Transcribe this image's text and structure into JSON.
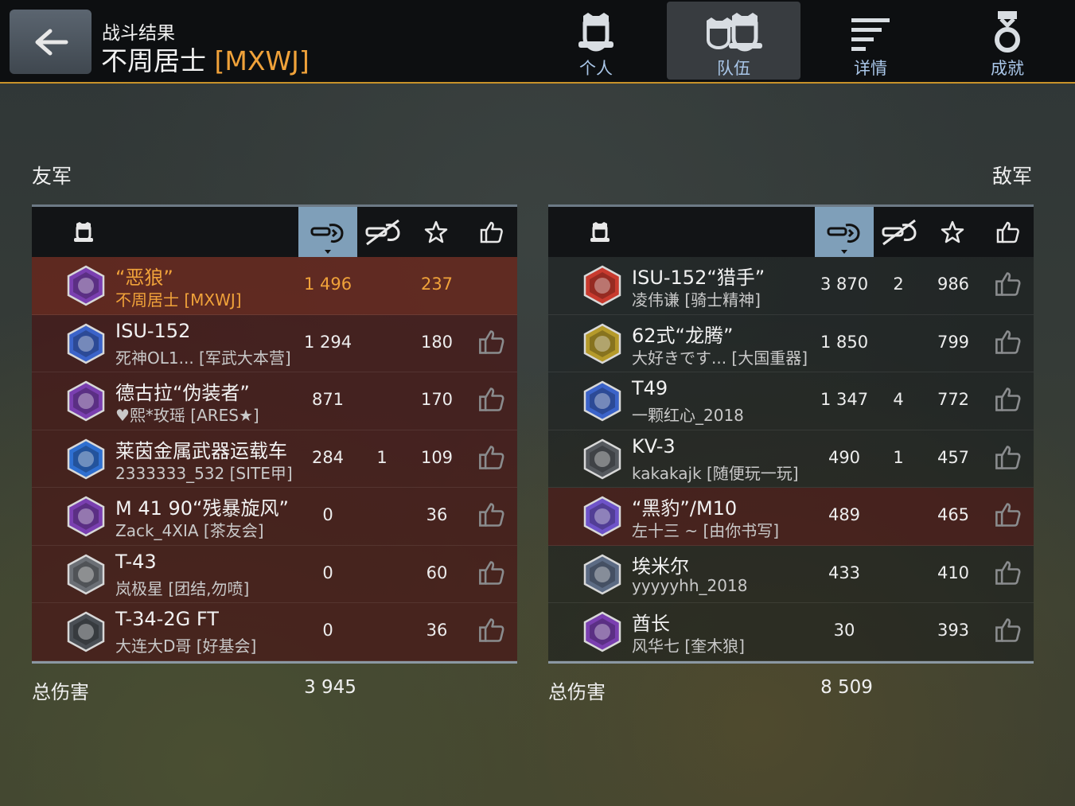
{
  "header": {
    "subtitle": "战斗结果",
    "player_name": "不周居士",
    "clan_tag": "[MXWJ]",
    "tabs": [
      {
        "label": "个人",
        "icon": "single-tank-icon",
        "active": false
      },
      {
        "label": "队伍",
        "icon": "team-tanks-icon",
        "active": true
      },
      {
        "label": "详情",
        "icon": "details-list-icon",
        "active": false
      },
      {
        "label": "成就",
        "icon": "medal-icon",
        "active": false
      }
    ]
  },
  "colors": {
    "accent": "#f0a23a",
    "tab_label": "#a9c6e8",
    "sorted_column": "#7f9fb9",
    "friendly_row": "#481616",
    "header_border": "#c8922a"
  },
  "columns": {
    "tank": "tank-icon",
    "damage": "damage-icon",
    "kills": "kills-icon",
    "score": "star-icon",
    "like": "thumbs-up-icon"
  },
  "allies": {
    "title": "友军",
    "rows": [
      {
        "tank": "“恶狼”",
        "player": "不周居士 [MXWJ]",
        "damage": "1 496",
        "kills": "",
        "score": "237",
        "self": true,
        "like": false,
        "badge": "#7a3fb0"
      },
      {
        "tank": "ISU-152",
        "player": "死神OL1... [军武大本营]",
        "damage": "1 294",
        "kills": "",
        "score": "180",
        "self": false,
        "like": true,
        "badge": "#3b63c9"
      },
      {
        "tank": "德古拉“伪装者”",
        "player": "♥熙*玫瑶 [ARES★]",
        "damage": "871",
        "kills": "",
        "score": "170",
        "self": false,
        "like": true,
        "badge": "#7a3fb0"
      },
      {
        "tank": "莱茵金属武器运载车",
        "player": "2333333_532 [SITE甲]",
        "damage": "284",
        "kills": "1",
        "score": "109",
        "self": false,
        "like": true,
        "badge": "#2f6fd0"
      },
      {
        "tank": "M 41 90“残暴旋风”",
        "player": "Zack_4XIA [茶友会]",
        "damage": "0",
        "kills": "",
        "score": "36",
        "self": false,
        "like": true,
        "badge": "#7a3fb0"
      },
      {
        "tank": "T-43",
        "player": "岚极星 [团结,勿喷]",
        "damage": "0",
        "kills": "",
        "score": "60",
        "self": false,
        "like": true,
        "badge": "#6b6f75"
      },
      {
        "tank": "T-34-2G FT",
        "player": "大连大D哥 [好基会]",
        "damage": "0",
        "kills": "",
        "score": "36",
        "self": false,
        "like": true,
        "badge": "#4a4f55"
      }
    ],
    "total_label": "总伤害",
    "total_damage": "3 945"
  },
  "enemies": {
    "title": "敌军",
    "rows": [
      {
        "tank": "ISU-152“猎手”",
        "player": "凌伟谦 [骑士精神]",
        "damage": "3 870",
        "kills": "2",
        "score": "986",
        "hl": false,
        "badge": "#c83a2e"
      },
      {
        "tank": "62式“龙腾”",
        "player": "大好きです... [大国重器]",
        "damage": "1 850",
        "kills": "",
        "score": "799",
        "hl": false,
        "badge": "#b59a2a"
      },
      {
        "tank": "T49",
        "player": "一颗红心_2018",
        "damage": "1 347",
        "kills": "4",
        "score": "772",
        "hl": false,
        "badge": "#3b63c9"
      },
      {
        "tank": "KV-3",
        "player": "kakakajk [随便玩一玩]",
        "damage": "490",
        "kills": "1",
        "score": "457",
        "hl": false,
        "badge": "#55595e"
      },
      {
        "tank": "“黑豹”/M10",
        "player": "左十三 ~ [由你书写]",
        "damage": "489",
        "kills": "",
        "score": "465",
        "hl": true,
        "badge": "#6e53c9"
      },
      {
        "tank": "埃米尔",
        "player": "yyyyyhh_2018",
        "damage": "433",
        "kills": "",
        "score": "410",
        "hl": false,
        "badge": "#5c6b84"
      },
      {
        "tank": "酋长",
        "player": "风华七 [奎木狼]",
        "damage": "30",
        "kills": "",
        "score": "393",
        "hl": false,
        "badge": "#7a3fb0"
      }
    ],
    "total_label": "总伤害",
    "total_damage": "8 509"
  }
}
